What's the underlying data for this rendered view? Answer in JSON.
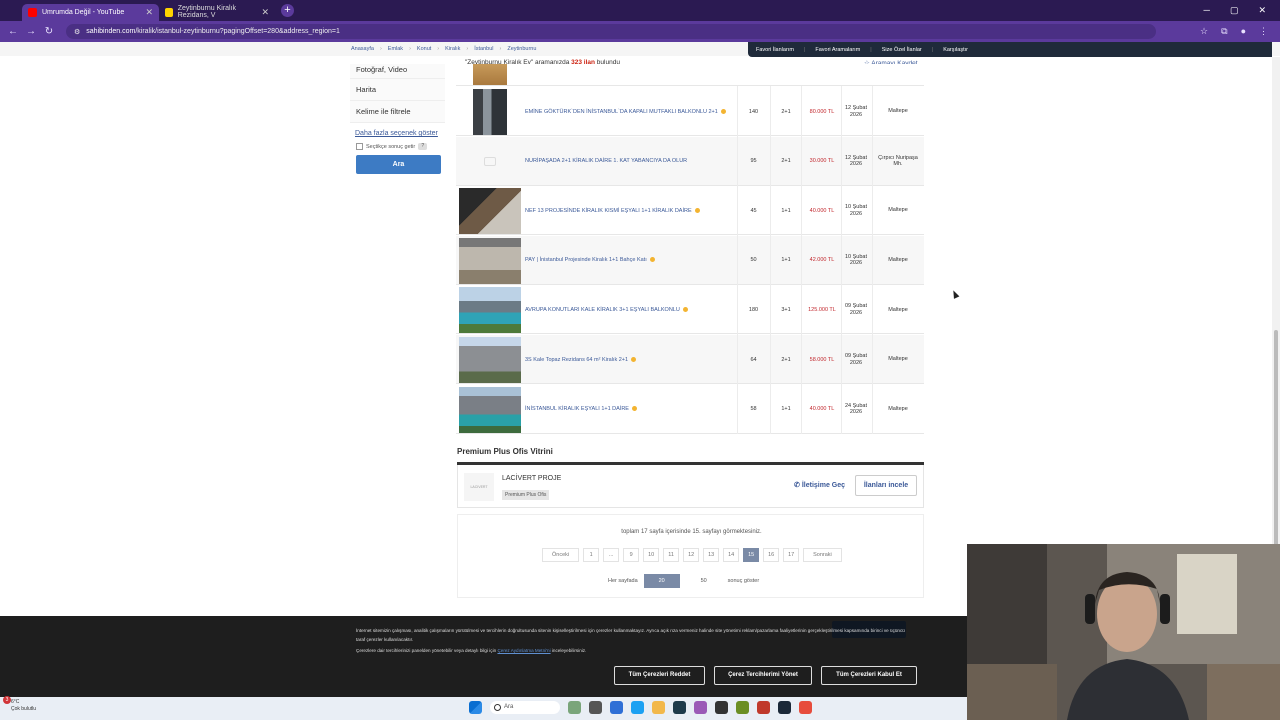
{
  "browser": {
    "tabs": [
      {
        "title": "Umrumda Değil - YouTube",
        "active": true
      },
      {
        "title": "Zeytinburnu Kiralık Rezidans, V",
        "active": false
      }
    ],
    "url_domain": "sahibinden.com",
    "url_path": "/kiralik/istanbul-zeytinburnu?pagingOffset=280&address_region=1"
  },
  "breadcrumb": [
    "Anasayfa",
    "Emlak",
    "Konut",
    "Kiralık",
    "İstanbul",
    "Zeytinburnu"
  ],
  "topnav": [
    "Favori İlanlarım",
    "Favori Aramalarım",
    "Size Özel İlanlar",
    "Karşılaştır"
  ],
  "search_info": {
    "query": "\"Zeytinburnu Kiralık Ev\"",
    "middle": " aramanızda ",
    "count": "323 ilan",
    "suffix": " bulundu",
    "save": "Aramayı Kaydet"
  },
  "filters": {
    "items": [
      "Fotoğraf, Video",
      "Harita",
      "Kelime ile filtrele"
    ],
    "more_options": "Daha fazla seçenek göster",
    "checkbox_label": "Seçtikçe sonuç getir",
    "help": "?",
    "search_button": "Ara"
  },
  "listings": [
    {
      "title": "EMİNE GÖKTÜRK`DEN İNİSTANBUL`DA KAPALI MUTFAKLI BALKONLU 2+1",
      "m2": "140",
      "rooms": "2+1",
      "price": "80.000 TL",
      "date": "12 Şubat 2026",
      "location": "Maltepe",
      "photo": "building"
    },
    {
      "title": "NURİPAŞADA 2+1 KİRALIK DAİRE 1. KAT YABANCIYA DA OLUR",
      "m2": "95",
      "rooms": "2+1",
      "price": "30.000 TL",
      "date": "12 Şubat 2026",
      "location": "Çırpıcı Nuripaşa Mh.",
      "photo": "none"
    },
    {
      "title": "NEF 13 PROJESİNDE KİRALIK KISMİ EŞYALI 1+1 KİRALIK DAİRE",
      "m2": "45",
      "rooms": "1+1",
      "price": "40.000 TL",
      "date": "10 Şubat 2026",
      "location": "Maltepe",
      "photo": "interior"
    },
    {
      "title": "PAY | İnistanbul Projesinde Kiralık 1+1 Bahçe Katı",
      "m2": "50",
      "rooms": "1+1",
      "price": "42.000 TL",
      "date": "10 Şubat 2026",
      "location": "Maltepe",
      "photo": "room"
    },
    {
      "title": "AVRUPA KONUTLARI KALE KİRALIK 3+1 EŞYALI BALKONLU",
      "m2": "180",
      "rooms": "3+1",
      "price": "125.000 TL",
      "date": "09 Şubat 2026",
      "location": "Maltepe",
      "photo": "pool"
    },
    {
      "title": "3S Kale Topaz Rezidans 64 m² Kiralık 2+1",
      "m2": "64",
      "rooms": "2+1",
      "price": "58.000 TL",
      "date": "09 Şubat 2026",
      "location": "Maltepe",
      "photo": "tower"
    },
    {
      "title": "İNİSTANBUL KİRALIK EŞYALI 1+1 DAİRE",
      "m2": "58",
      "rooms": "1+1",
      "price": "40.000 TL",
      "date": "24 Şubat 2026",
      "location": "Maltepe",
      "photo": "pool2"
    }
  ],
  "premium": {
    "title": "Premium Plus Ofis Vitrini",
    "logo_text": "LACIVERT",
    "name": "LACİVERT PROJE",
    "badge": "Premium Plus Ofis",
    "contact": "İletişime Geç",
    "inspect": "İlanları incele"
  },
  "pagination": {
    "info": "toplam 17 sayfa içerisinde 15. sayfayı görmektesiniz.",
    "prev": "Önceki",
    "next": "Sonraki",
    "pages": [
      "1",
      "...",
      "9",
      "10",
      "11",
      "12",
      "13",
      "14",
      "15",
      "16",
      "17"
    ],
    "current": "15",
    "per_page_label": "Her sayfada",
    "per_page_options": [
      "20",
      "50"
    ],
    "per_page_current": "20",
    "per_page_suffix": "sonuç göster"
  },
  "cookie": {
    "text1": "İnternet sitemizin çalışması, analitik çalışmaların yürütülmesi ve tercihlerin doğrultusunda sitenin kişiselleştirilmesi için çerezler kullanmaktayız. Ayrıca açık rıza vermeniz halinde site yönetimi reklam/pazarlama faaliyetlerinin gerçekleştirilmesi kapsamında birinci ve üçüncü taraf çerezler kullanılacaktır.",
    "text2_pre": "Çerezlere dair tercihlerinizi panelden yönetebilir veya detaylı bilgi için ",
    "text2_link": "Çerez Aydınlatma Metni'ni",
    "text2_post": " inceleyebilirsiniz.",
    "reject": "Tüm Çerezleri Reddet",
    "manage": "Çerez Tercihlerimi Yönet",
    "accept": "Tüm Çerezleri Kabul Et"
  },
  "taskbar": {
    "temp": "6°C",
    "weather": "Çok bulutlu",
    "badge": "3",
    "search": "Ara"
  }
}
